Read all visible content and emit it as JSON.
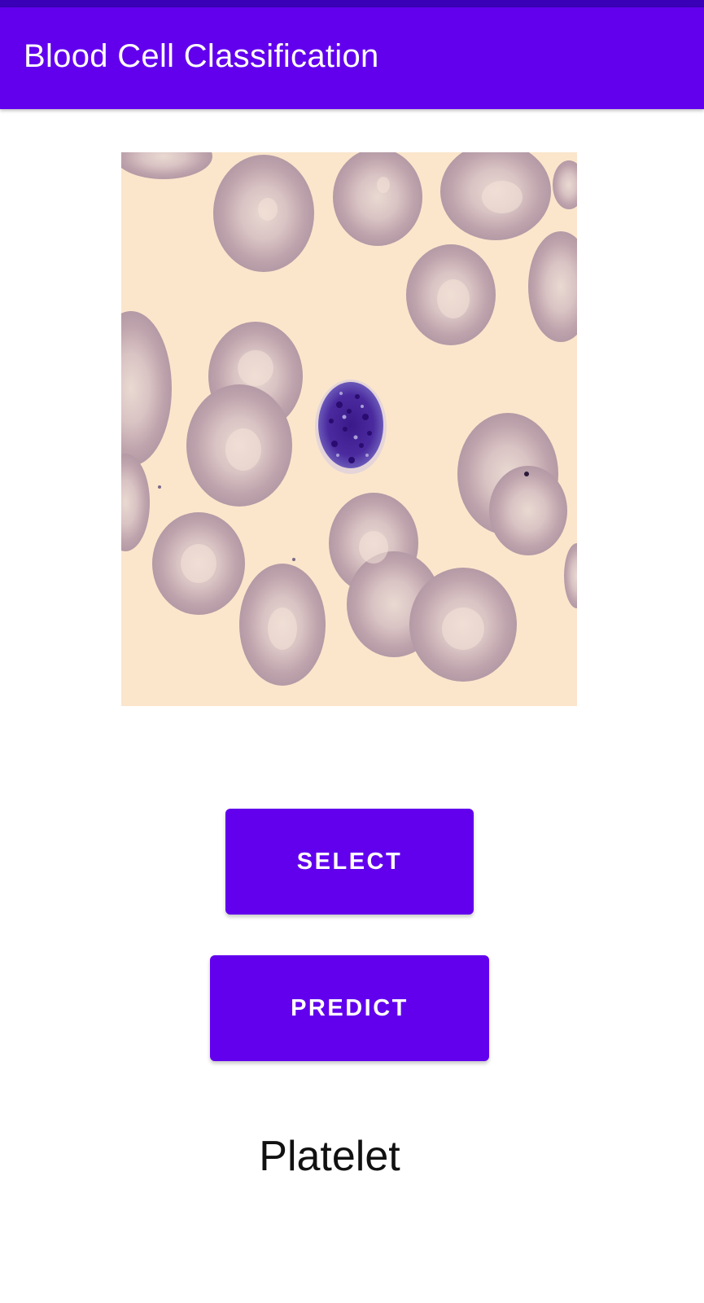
{
  "app_bar": {
    "title": "Blood Cell Classification",
    "color": "#6200ee"
  },
  "image_view": {
    "content": "blood-smear-micrograph"
  },
  "buttons": {
    "select_label": "SELECT",
    "predict_label": "PREDICT"
  },
  "result": {
    "label": "Platelet"
  },
  "colors": {
    "accent": "#6200ee",
    "status_bar": "#3a00b8",
    "button_text": "#ffffff"
  }
}
